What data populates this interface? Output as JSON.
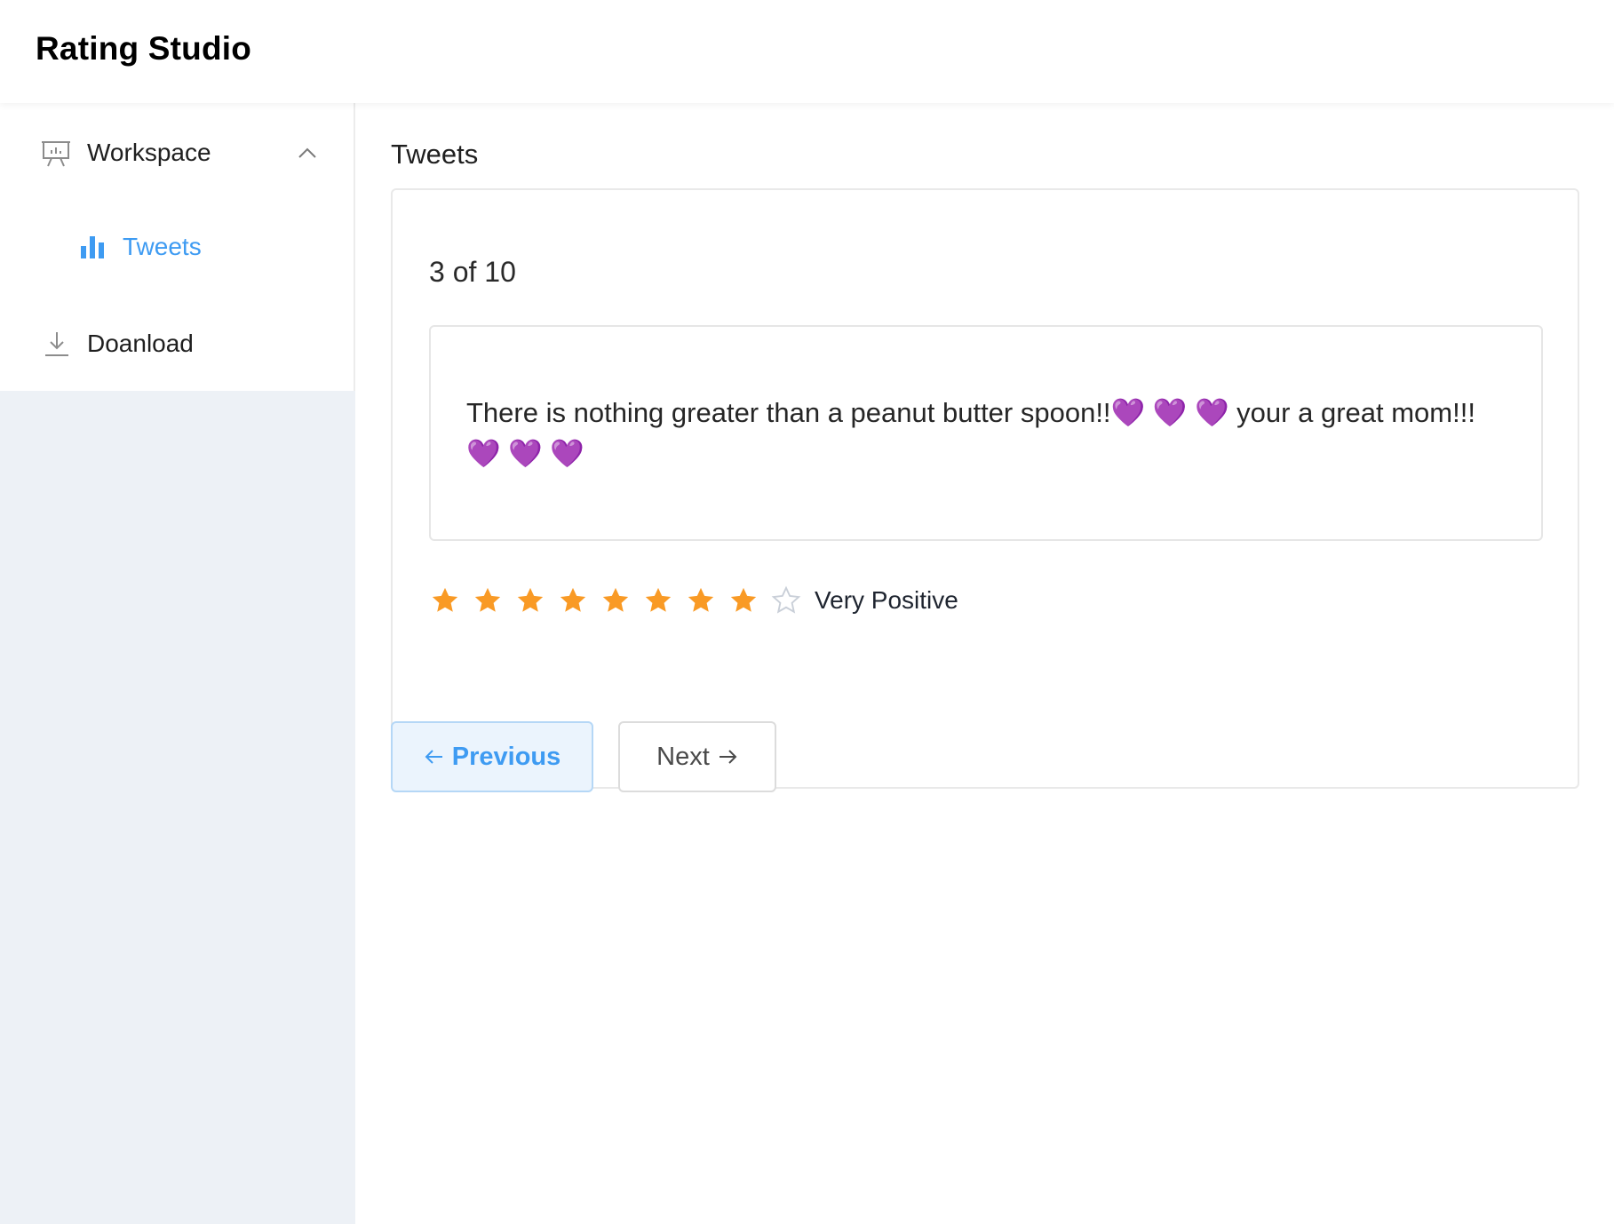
{
  "header": {
    "app_title": "Rating Studio"
  },
  "sidebar": {
    "items": [
      {
        "label": "Workspace",
        "icon": "presentation-board-icon",
        "expanded": true
      },
      {
        "label": "Tweets",
        "icon": "bar-chart-icon",
        "active": true
      },
      {
        "label": "Doanload",
        "icon": "download-icon"
      }
    ]
  },
  "main": {
    "page_title": "Tweets",
    "counter": "3 of 10",
    "tweet_text": "There is nothing greater than a peanut butter spoon!!💜 💜 💜 your a great mom!!! 💜 💜 💜",
    "rating": {
      "max": 9,
      "value": 8,
      "label": "Very Positive"
    },
    "buttons": {
      "previous_label": "Previous",
      "next_label": "Next"
    }
  },
  "colors": {
    "accent": "#3e9bf2",
    "star_filled": "#f99a25",
    "star_empty": "#c9cfd8",
    "sidebar_bg": "#edf1f6"
  }
}
